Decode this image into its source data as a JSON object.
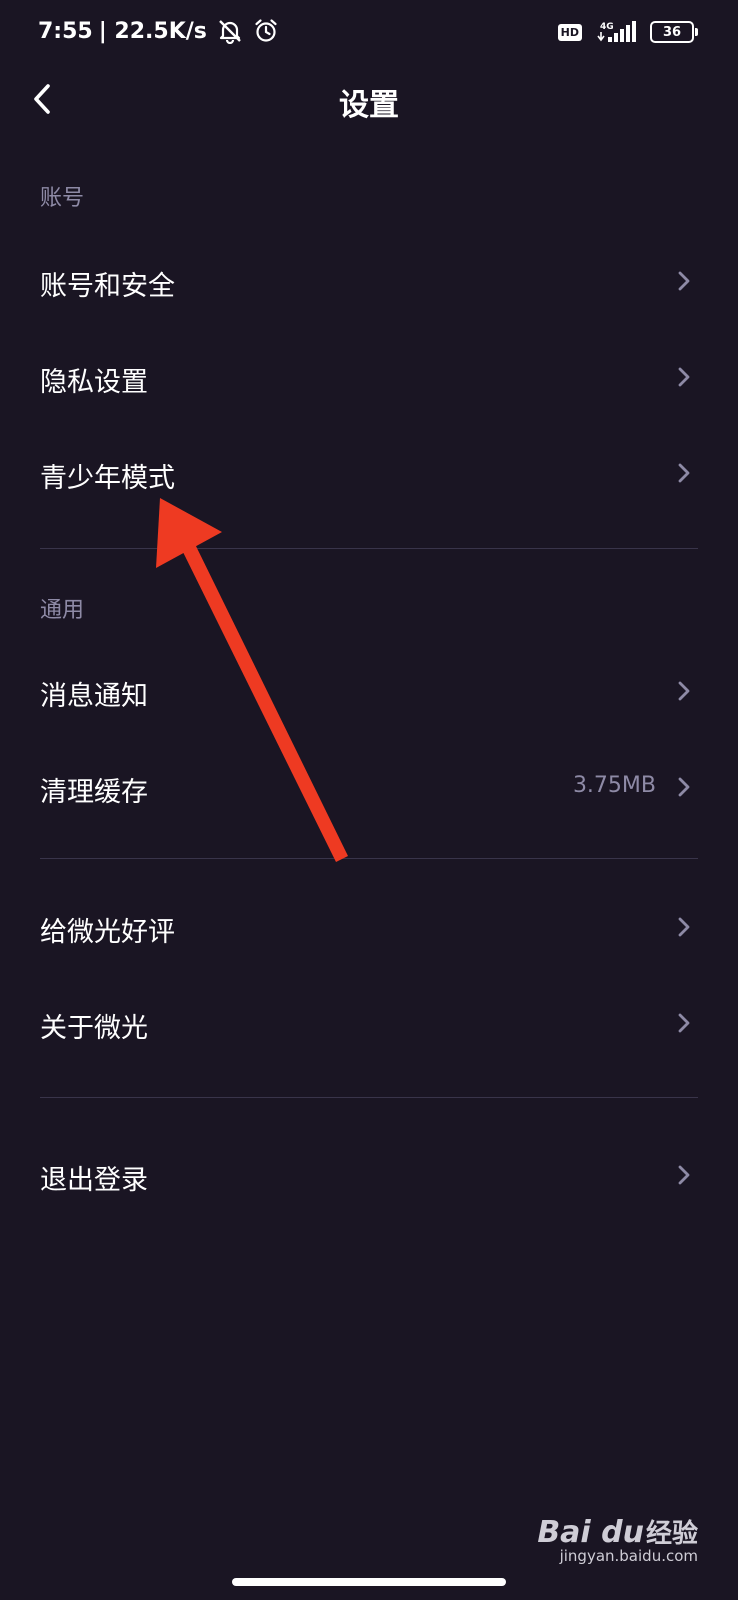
{
  "status_bar": {
    "time": "7:55",
    "network_speed": "| 22.5K/s",
    "mute_icon": "bell-off-icon",
    "alarm_icon": "alarm-icon",
    "hd_badge": "HD",
    "network_type": "4G",
    "battery_level": "36"
  },
  "header": {
    "back_icon": "chevron-left-icon",
    "title": "设置"
  },
  "sections": {
    "account": {
      "label": "账号",
      "items": [
        {
          "label": "账号和安全"
        },
        {
          "label": "隐私设置"
        },
        {
          "label": "青少年模式"
        }
      ]
    },
    "general": {
      "label": "通用",
      "items": [
        {
          "label": "消息通知"
        },
        {
          "label": "清理缓存",
          "value": "3.75MB"
        }
      ]
    },
    "about": {
      "items": [
        {
          "label": "给微光好评"
        },
        {
          "label": "关于微光"
        }
      ]
    },
    "logout": {
      "items": [
        {
          "label": "退出登录"
        }
      ]
    }
  },
  "colors": {
    "background": "#1a1523",
    "secondary_text": "#8e8aa6",
    "divider": "#39344a",
    "annotation_arrow": "#ee3a22"
  },
  "watermark": {
    "logo": "Bai du",
    "logo_cn": "经验",
    "url": "jingyan.baidu.com"
  }
}
